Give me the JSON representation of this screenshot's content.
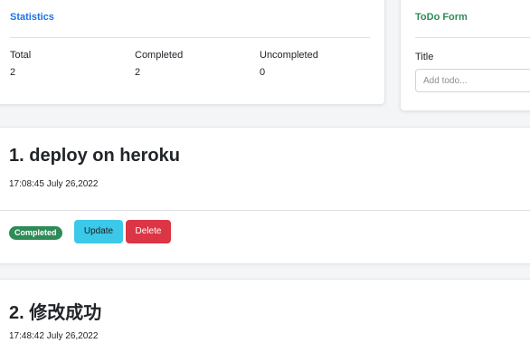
{
  "statistics": {
    "title": "Statistics",
    "columns": [
      {
        "label": "Total",
        "value": "2"
      },
      {
        "label": "Completed",
        "value": "2"
      },
      {
        "label": "Uncompleted",
        "value": "0"
      }
    ]
  },
  "todo_form": {
    "title": "ToDo Form",
    "title_label": "Title",
    "input_placeholder": "Add todo..."
  },
  "todos": [
    {
      "title": "1. deploy on heroku",
      "timestamp": "17:08:45 July 26,2022",
      "status": "Completed",
      "update_label": "Update",
      "delete_label": "Delete"
    },
    {
      "title": "2. 修改成功",
      "timestamp": "17:48:42 July 26,2022"
    }
  ],
  "colors": {
    "stats_title": "#1a73e8",
    "form_title": "#2e8b57",
    "completed_badge": "#2e8b57",
    "update_button": "#3cc8e8",
    "delete_button": "#dc3545"
  }
}
